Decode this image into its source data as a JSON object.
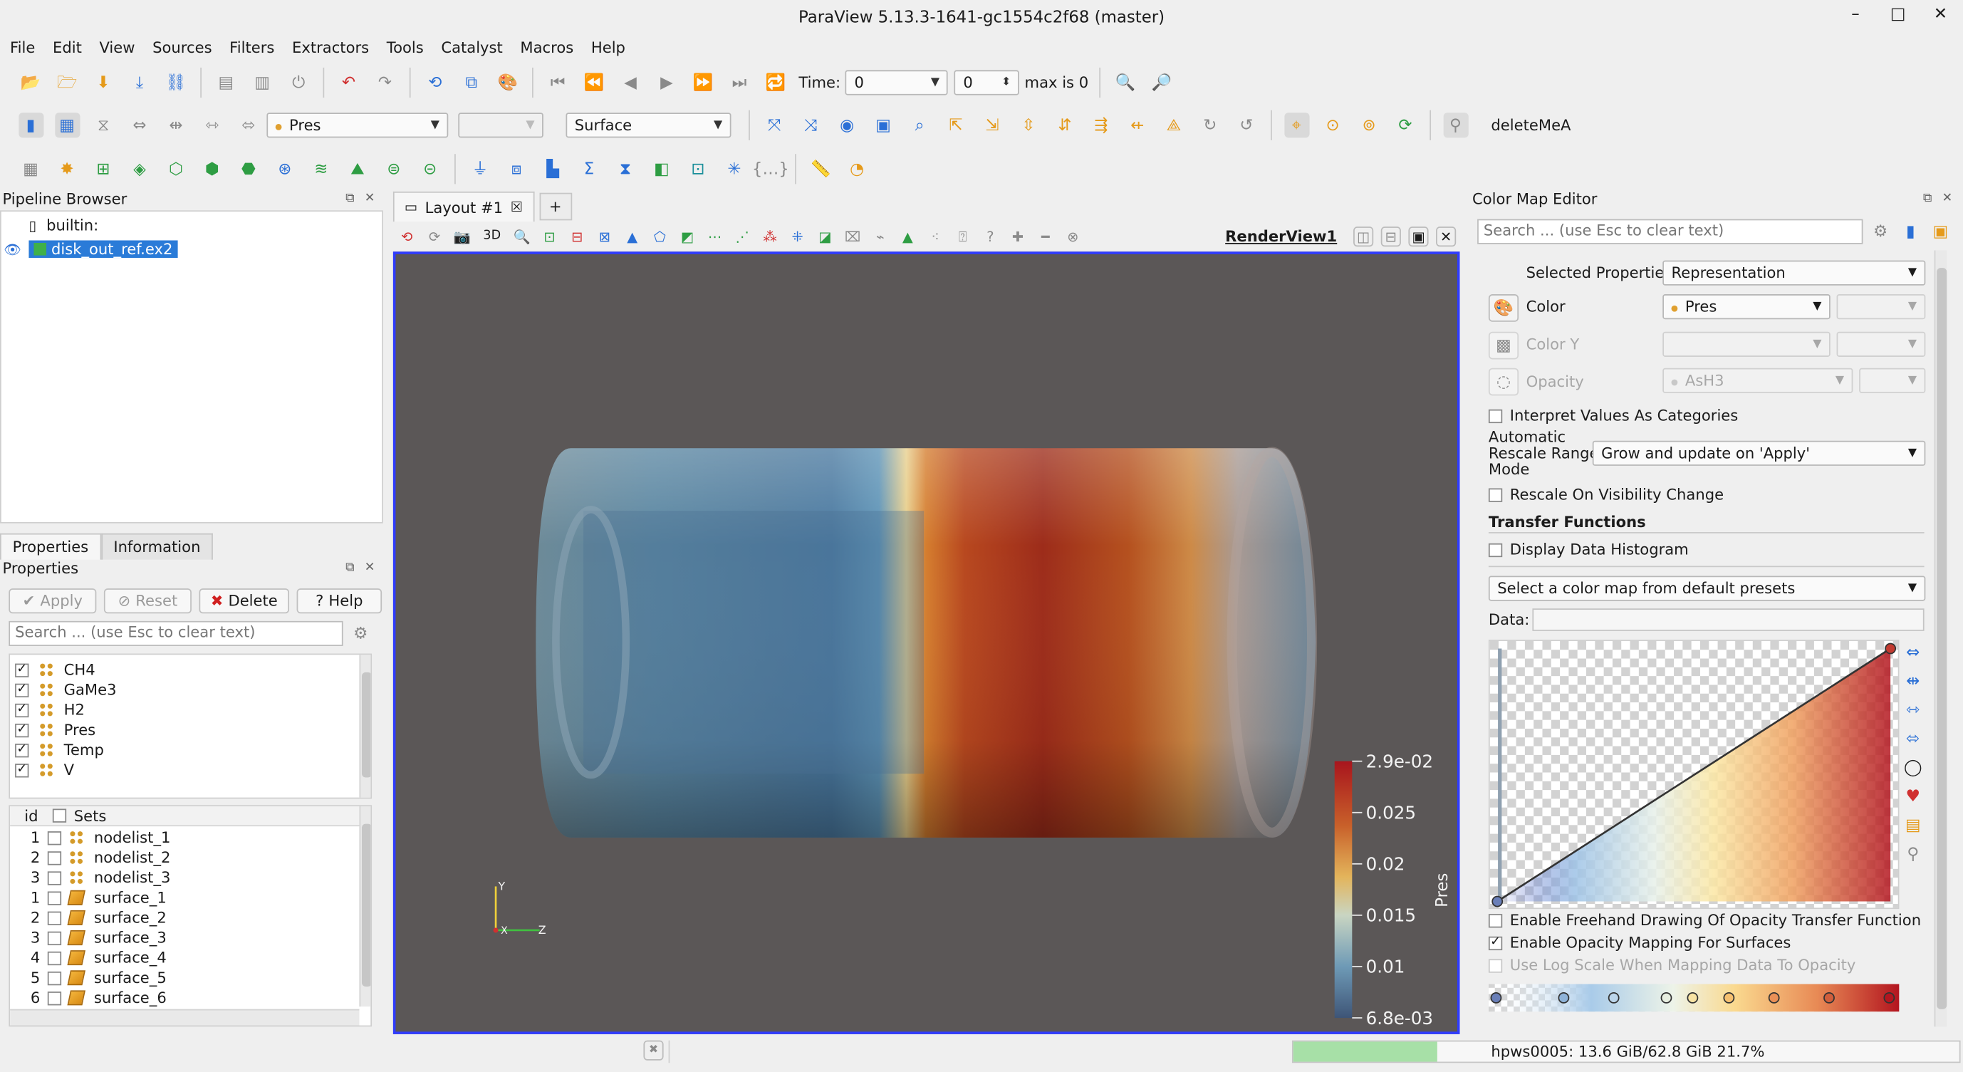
{
  "window": {
    "title": "ParaView 5.13.3-1641-gc1554c2f68 (master)",
    "controls": [
      "–",
      "□",
      "✕"
    ]
  },
  "menu": [
    "File",
    "Edit",
    "View",
    "Sources",
    "Filters",
    "Extractors",
    "Tools",
    "Catalyst",
    "Macros",
    "Help"
  ],
  "toolbar_time": {
    "time_label": "Time:",
    "time_value": "0",
    "step_value": "0",
    "max_label": "max is 0"
  },
  "toolbar_display": {
    "color_by": "Pres",
    "component": "",
    "representation": "Surface",
    "macro": "deleteMeA"
  },
  "pipeline": {
    "title": "Pipeline Browser",
    "items": [
      {
        "label": "builtin:"
      },
      {
        "label": "disk_out_ref.ex2"
      }
    ]
  },
  "properties_tabs": [
    "Properties",
    "Information"
  ],
  "properties": {
    "title": "Properties",
    "apply": "Apply",
    "reset": "Reset",
    "delete": "Delete",
    "help": "Help",
    "search_placeholder": "Search ... (use Esc to clear text)",
    "variables": [
      {
        "name": "CH4",
        "checked": true
      },
      {
        "name": "GaMe3",
        "checked": true
      },
      {
        "name": "H2",
        "checked": true
      },
      {
        "name": "Pres",
        "checked": true
      },
      {
        "name": "Temp",
        "checked": true
      },
      {
        "name": "V",
        "checked": true
      }
    ],
    "sets_header": {
      "id": "id",
      "sets": "Sets"
    },
    "sets": [
      {
        "id": "1",
        "name": "nodelist_1",
        "kind": "node"
      },
      {
        "id": "2",
        "name": "nodelist_2",
        "kind": "node"
      },
      {
        "id": "3",
        "name": "nodelist_3",
        "kind": "node"
      },
      {
        "id": "1",
        "name": "surface_1",
        "kind": "surface"
      },
      {
        "id": "2",
        "name": "surface_2",
        "kind": "surface"
      },
      {
        "id": "3",
        "name": "surface_3",
        "kind": "surface"
      },
      {
        "id": "4",
        "name": "surface_4",
        "kind": "surface"
      },
      {
        "id": "5",
        "name": "surface_5",
        "kind": "surface"
      },
      {
        "id": "6",
        "name": "surface_6",
        "kind": "surface"
      }
    ]
  },
  "layout": {
    "tab_label": "Layout #1",
    "add_tab": "+",
    "view_name": "RenderView1",
    "view_3d": "3D"
  },
  "render": {
    "background": "#5b5757",
    "color_legend": {
      "title": "Pres",
      "labels": [
        "2.9e-02",
        "0.025",
        "0.02",
        "0.015",
        "0.01",
        "6.8e-03"
      ],
      "max": 0.029,
      "min": 0.0068
    },
    "axes": {
      "y": "Y",
      "x": "X",
      "z": "Z"
    }
  },
  "color_map_editor": {
    "title": "Color Map Editor",
    "search_placeholder": "Search ... (use Esc to clear text)",
    "selected_properties_label": "Selected Properties",
    "selected_properties_value": "Representation",
    "color_label": "Color",
    "color_value": "Pres",
    "color_y_label": "Color Y",
    "opacity_label": "Opacity",
    "opacity_value": "AsH3",
    "interpret_categories": "Interpret Values As Categories",
    "auto_rescale_label_1": "Automatic",
    "auto_rescale_label_2": "Rescale Range",
    "auto_rescale_label_3": "Mode",
    "auto_rescale_value": "Grow and update on 'Apply'",
    "rescale_visibility": "Rescale On Visibility Change",
    "transfer_functions": "Transfer Functions",
    "display_histogram": "Display Data Histogram",
    "preset_placeholder": "Select a color map from default presets",
    "data_label": "Data:",
    "freehand": "Enable Freehand Drawing Of Opacity Transfer Function",
    "opacity_mapping": "Enable Opacity Mapping For Surfaces",
    "log_scale": "Use Log Scale When Mapping Data To Opacity"
  },
  "status": {
    "memory": "hpws0005: 13.6 GiB/62.8 GiB 21.7%",
    "memory_fraction": 0.217
  }
}
